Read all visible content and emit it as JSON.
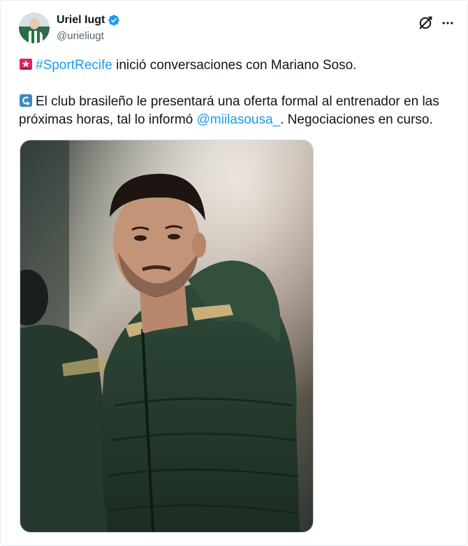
{
  "author": {
    "display_name": "Uriel Iugt",
    "handle": "@urieliugt"
  },
  "tweet": {
    "line1_hashtag": "#SportRecife",
    "line1_rest": " inició conversaciones con Mariano Soso.",
    "line2_pre": "El club brasileño le presentará una oferta formal al entrenador en las próximas horas, tal lo informó ",
    "line2_mention": "@miilasousa_",
    "line2_post": ". Negociaciones en curso."
  },
  "icons": {
    "verified": "verified-badge-icon",
    "grok": "grok-icon",
    "more": "more-options-icon",
    "siren": "siren-emoji-icon",
    "return": "return-arrow-emoji-icon"
  },
  "colors": {
    "link": "#1d9bf0",
    "text": "#0f1419",
    "secondary": "#536471",
    "border": "#cfd9de"
  },
  "media": {
    "photo_subject": "man-in-green-puffer-jacket"
  }
}
